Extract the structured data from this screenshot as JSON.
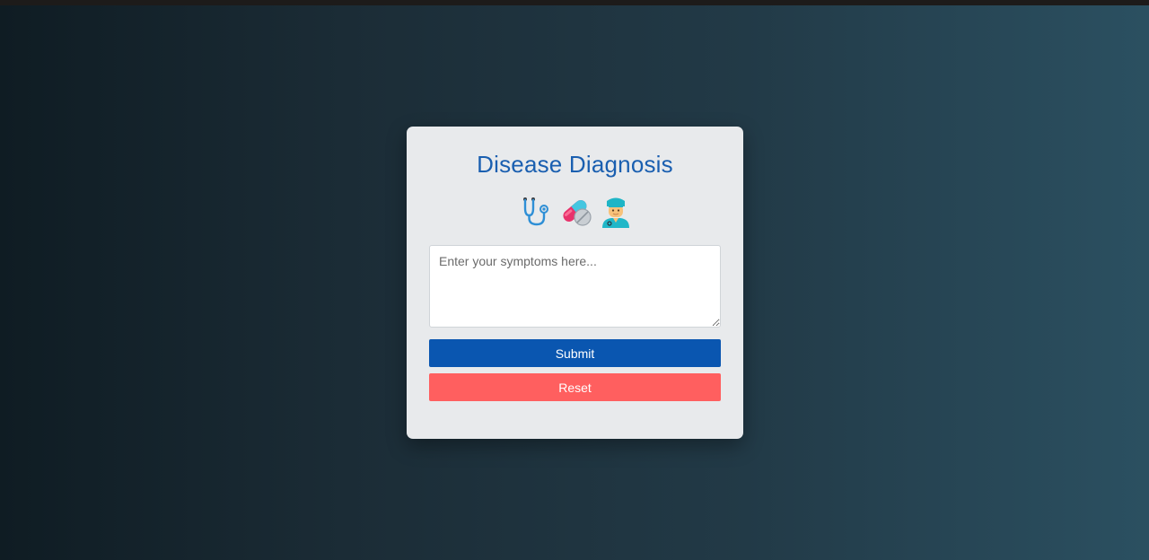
{
  "form": {
    "title": "Disease Diagnosis",
    "icons": [
      "stethoscope-icon",
      "pill-icon",
      "health-worker-icon"
    ],
    "symptoms_placeholder": "Enter your symptoms here...",
    "symptoms_value": "",
    "submit_label": "Submit",
    "reset_label": "Reset"
  },
  "colors": {
    "background_left": "#0f1c23",
    "background_right": "#2b5061",
    "card": "#e8eaec",
    "title": "#1a5fb0",
    "submit": "#0a56b0",
    "reset": "#ff5f5f"
  }
}
